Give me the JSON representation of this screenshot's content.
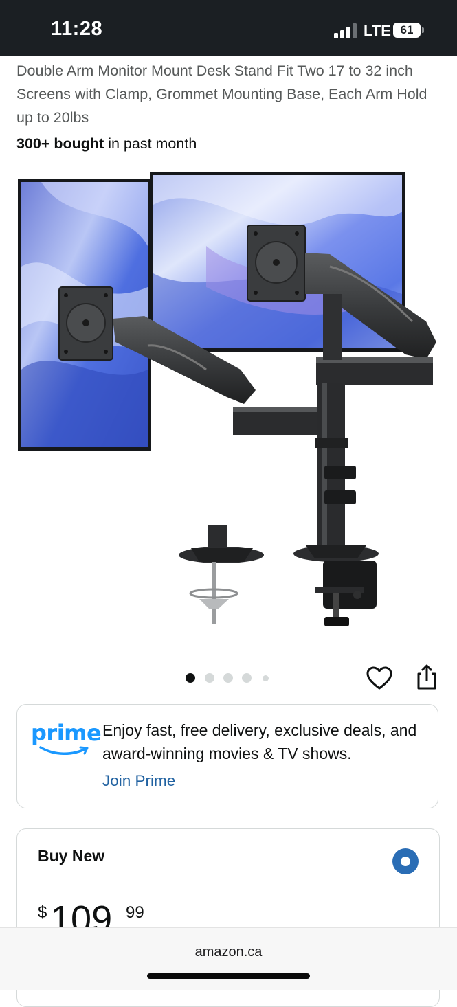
{
  "status_bar": {
    "time": "11:28",
    "network": "LTE",
    "battery": "61"
  },
  "product": {
    "title": "Double Arm Monitor Mount Desk Stand Fit Two 17 to 32 inch Screens with Clamp, Grommet Mounting Base, Each Arm Hold up to 20lbs",
    "bought_count": "300+ bought",
    "bought_suffix": " in past month",
    "image_name": "dual-monitor-arm-mount-image",
    "carousel": {
      "count": 5,
      "active_index": 0
    }
  },
  "prime": {
    "logo": "prime",
    "message": "Enjoy fast, free delivery, exclusive deals, and award-winning movies & TV shows.",
    "link": "Join Prime",
    "brand_color": "#1a98ff",
    "link_color": "#2162a1"
  },
  "buy": {
    "label": "Buy New",
    "currency": "$",
    "price_whole": "109",
    "price_fraction": "99",
    "radio_color": "#2a6db5"
  },
  "browser": {
    "domain": "amazon.ca"
  },
  "icons": {
    "heart": "heart-icon",
    "share": "share-icon"
  }
}
